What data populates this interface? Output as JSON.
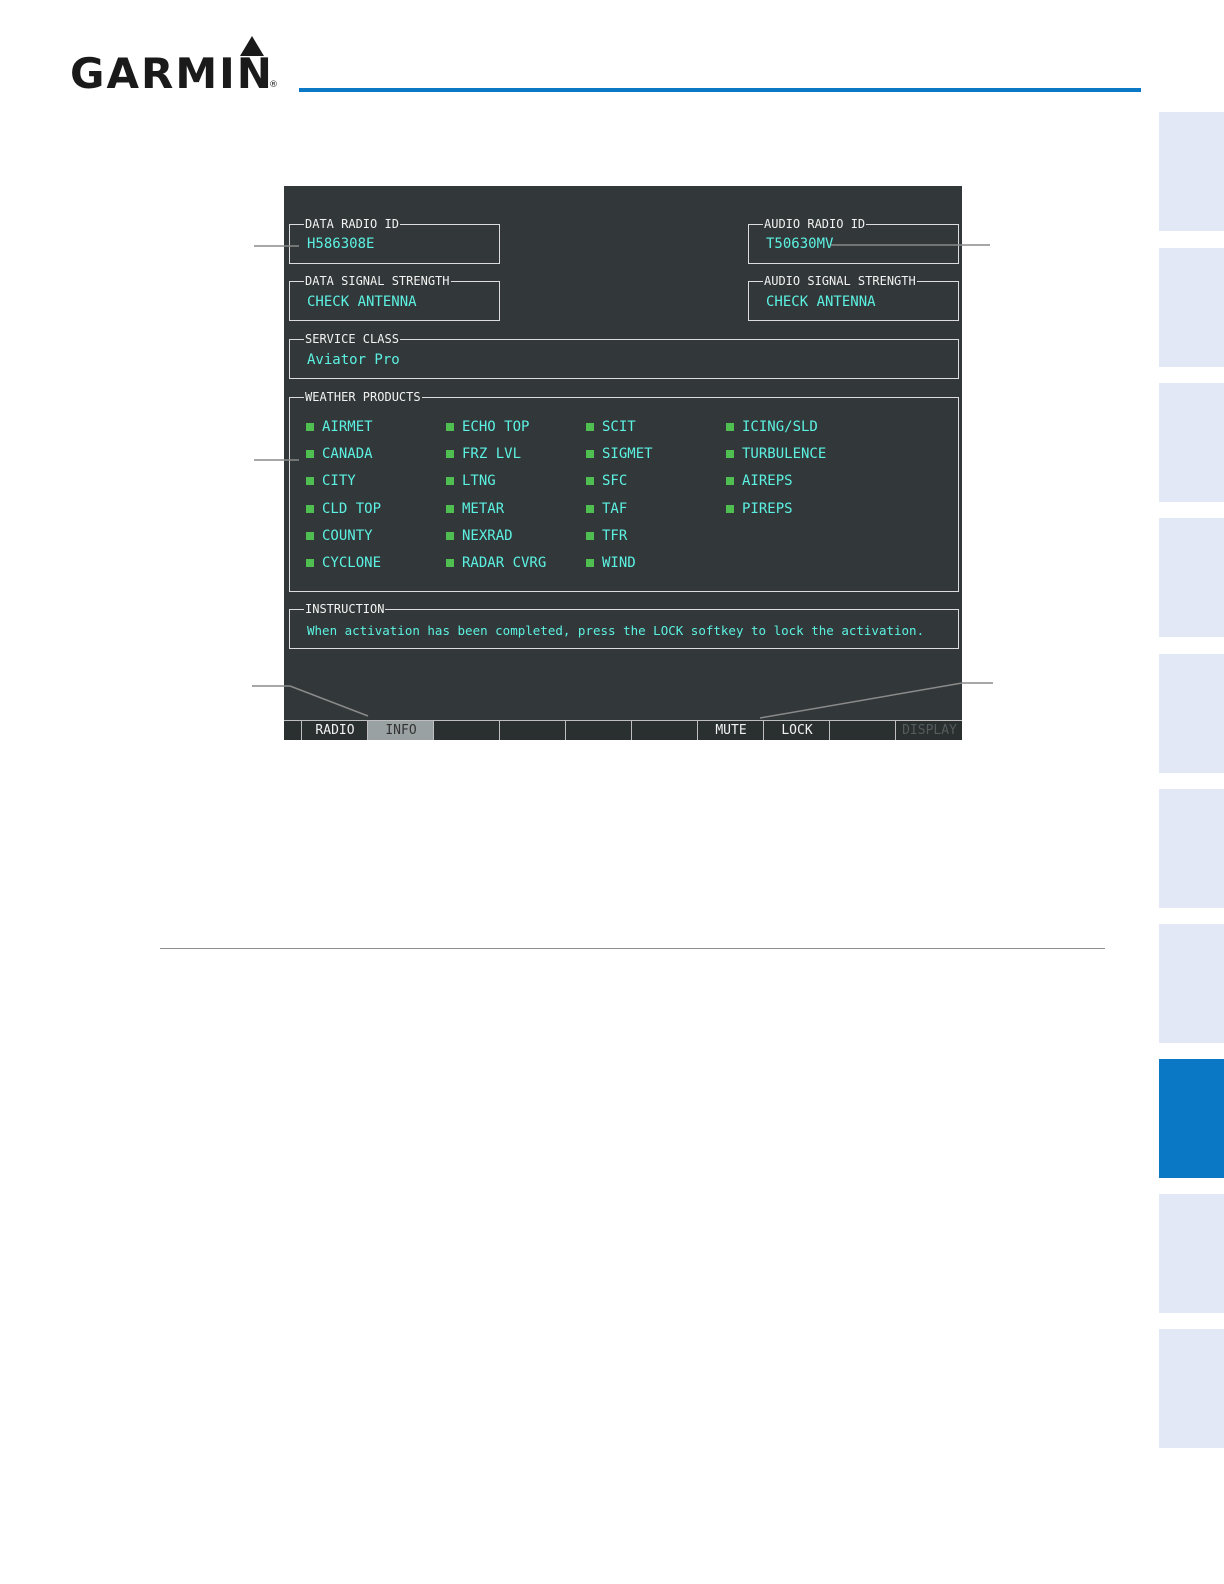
{
  "brand": {
    "name": "GARMIN",
    "reg": "®"
  },
  "screen": {
    "data_radio_id": {
      "label": "DATA RADIO ID",
      "value": "H586308E"
    },
    "audio_radio_id": {
      "label": "AUDIO RADIO ID",
      "value": "T50630MV"
    },
    "data_signal_strength": {
      "label": "DATA SIGNAL STRENGTH",
      "value": "CHECK ANTENNA"
    },
    "audio_signal_strength": {
      "label": "AUDIO SIGNAL STRENGTH",
      "value": "CHECK ANTENNA"
    },
    "service_class": {
      "label": "SERVICE CLASS",
      "value": "Aviator Pro"
    },
    "weather_products": {
      "label": "WEATHER PRODUCTS",
      "columns": [
        [
          "AIRMET",
          "CANADA",
          "CITY",
          "CLD TOP",
          "COUNTY",
          "CYCLONE"
        ],
        [
          "ECHO TOP",
          "FRZ LVL",
          "LTNG",
          "METAR",
          "NEXRAD",
          "RADAR CVRG"
        ],
        [
          "SCIT",
          "SIGMET",
          "SFC",
          "TAF",
          "TFR",
          "WIND"
        ],
        [
          "ICING/SLD",
          "TURBULENCE",
          "AIREPS",
          "PIREPS"
        ]
      ]
    },
    "instruction": {
      "label": "INSTRUCTION",
      "value": "When activation has been completed, press the LOCK softkey to lock the activation."
    },
    "softkeys": [
      "",
      "RADIO",
      "INFO",
      "",
      "",
      "",
      "",
      "MUTE",
      "LOCK",
      "",
      "DISPLAY"
    ]
  },
  "colors": {
    "accent": "#0b78c6",
    "screen_bg": "#323839",
    "value_text": "#5cf2e3",
    "indicator": "#4fbf52",
    "side_tab": "#e3e8f7"
  }
}
